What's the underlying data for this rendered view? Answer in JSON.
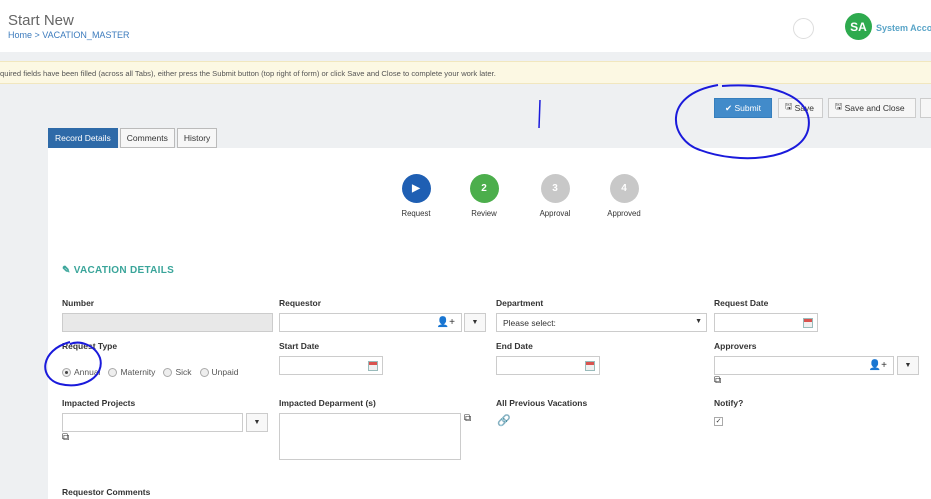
{
  "header": {
    "title": "Start New",
    "breadcrumb": "Home > VACATION_MASTER",
    "user_initials": "SA",
    "user_name": "System Acco"
  },
  "banner": {
    "text": "quired fields have been filled (across all Tabs), either press the Submit button (top right of form) or click Save and Close to complete your work later."
  },
  "toolbar": {
    "submit_label": "Submit",
    "save_label": "Save",
    "save_close_label": "Save and Close"
  },
  "tabs": [
    {
      "label": "Record Details",
      "active": true
    },
    {
      "label": "Comments",
      "active": false
    },
    {
      "label": "History",
      "active": false
    }
  ],
  "steps": [
    {
      "number": "",
      "label": "Request",
      "color": "#1f5fb3"
    },
    {
      "number": "2",
      "label": "Review",
      "color": "#4cae4c"
    },
    {
      "number": "3",
      "label": "Approval",
      "color": "#c8c8c8"
    },
    {
      "number": "4",
      "label": "Approved",
      "color": "#c8c8c8"
    }
  ],
  "section": {
    "title": "VACATION DETAILS"
  },
  "fields": {
    "number_label": "Number",
    "requestor_label": "Requestor",
    "department_label": "Department",
    "department_value": "Please select:",
    "request_date_label": "Request Date",
    "request_type_label": "Request Type",
    "start_date_label": "Start Date",
    "end_date_label": "End Date",
    "approvers_label": "Approvers",
    "impacted_projects_label": "Impacted Projects",
    "impacted_department_label": "Impacted Deparment (s)",
    "all_previous_vacations_label": "All Previous Vacations",
    "notify_label": "Notify?",
    "requestor_comments_label": "Requestor Comments"
  },
  "request_type_options": [
    {
      "label": "Annual",
      "checked": true
    },
    {
      "label": "Maternity",
      "checked": false
    },
    {
      "label": "Sick",
      "checked": false
    },
    {
      "label": "Unpaid",
      "checked": false
    }
  ],
  "colors": {
    "accent": "#428bca",
    "section_title": "#3aa59a",
    "annotation_ink": "#1a1adb"
  }
}
